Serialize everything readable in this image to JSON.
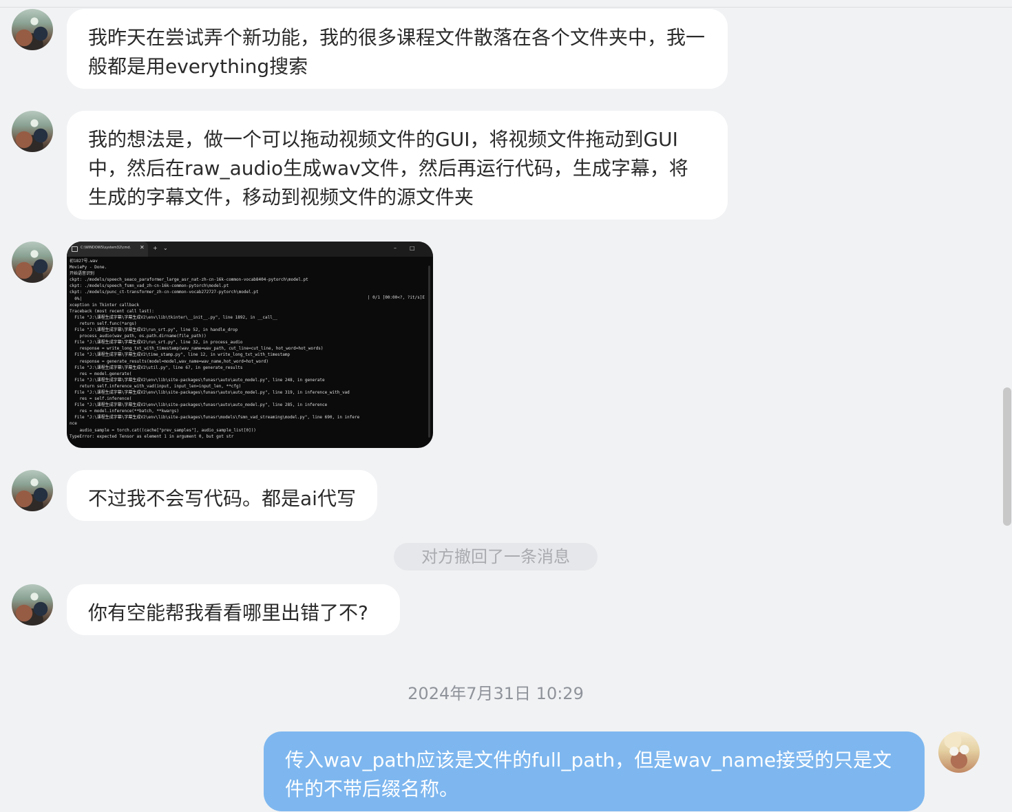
{
  "conversation": {
    "messages": [
      {
        "text": "我昨天在尝试弄个新功能，我的很多课程文件散落在各个文件夹中，我一般都是用everything搜索"
      },
      {
        "text": "我的想法是，做一个可以拖动视频文件的GUI，将视频文件拖动到GUI中，然后在raw_audio生成wav文件，然后再运行代码，生成字幕，将生成的字幕文件，移动到视频文件的源文件夹"
      },
      {
        "image": {
          "tab_title": "C:\\WINDOWS\\system32\\cmd.",
          "tab_close": "✕",
          "tab_add": "+",
          "tab_dropdown": "⌄",
          "window_minimize": "–",
          "window_maximize": "□",
          "progress_text": "| 0/1 [00:00<?, ?it/s]E",
          "content": "初1827号.wav\nMoviePy - Done.\n开始语音识别\nckpt: ./models/speech_seaco_paraformer_large_asr_nat-zh-cn-16k-common-vocab8404-pytorch\\model.pt\nckpt: ./models/speech_fsmn_vad_zh-cn-16k-common-pytorch\\model.pt\nckpt: ./models/punc_ct-transformer_zh-cn-common-vocab272727-pytorch\\model.pt\n  0%|\nxception in Tkinter callback\nTraceback (most recent call last):\n  File \"J:\\课程生成字幕\\字幕生成V2\\env\\lib\\tkinter\\__init__.py\", line 1892, in __call__\n    return self.func(*args)\n  File \"J:\\课程生成字幕\\字幕生成V2\\run_srt.py\", line 52, in handle_drop\n    process_audio(wav_path, os.path.dirname(file_path))\n  File \"J:\\课程生成字幕\\字幕生成V2\\run_srt.py\", line 32, in process_audio\n    response = write_long_txt_with_timestamp(wav_name=wav_path, cut_line=cut_line, hot_word=hot_words)\n  File \"J:\\课程生成字幕\\字幕生成V2\\time_stamp.py\", line 12, in write_long_txt_with_timestamp\n    response = generate_results(model=model,wav_name=wav_name,hot_word=hot_word)\n  File \"J:\\课程生成字幕\\字幕生成V2\\util.py\", line 67, in generate_results\n    res = model.generate(\n  File \"J:\\课程生成字幕\\字幕生成V2\\env\\lib\\site-packages\\funasr\\auto\\auto_model.py\", line 248, in generate\n    return self.inference_with_vad(input, input_len=input_len, **cfg)\n  File \"J:\\课程生成字幕\\字幕生成V2\\env\\lib\\site-packages\\funasr\\auto\\auto_model.py\", line 319, in inference_with_vad\n    res = self.inference(\n  File \"J:\\课程生成字幕\\字幕生成V2\\env\\lib\\site-packages\\funasr\\auto\\auto_model.py\", line 285, in inference\n    res = model.inference(**batch, **kwargs)\n  File \"J:\\课程生成字幕\\字幕生成V2\\env\\lib\\site-packages\\funasr\\models\\fsmn_vad_streaming\\model.py\", line 690, in infere\nnce\n    audio_sample = torch.cat((cache[\"prev_samples\"], audio_sample_list[0]))\nTypeError: expected Tensor as element 1 in argument 0, but got str"
        }
      },
      {
        "text": "不过我不会写代码。都是ai代写"
      },
      {
        "notice": "对方撤回了一条消息"
      },
      {
        "text": "你有空能帮我看看哪里出错了不?"
      },
      {
        "timestamp": "2024年7月31日 10:29"
      },
      {
        "text": "传入wav_path应该是文件的full_path，但是wav_name接受的只是文件的不带后缀名称。"
      }
    ]
  }
}
